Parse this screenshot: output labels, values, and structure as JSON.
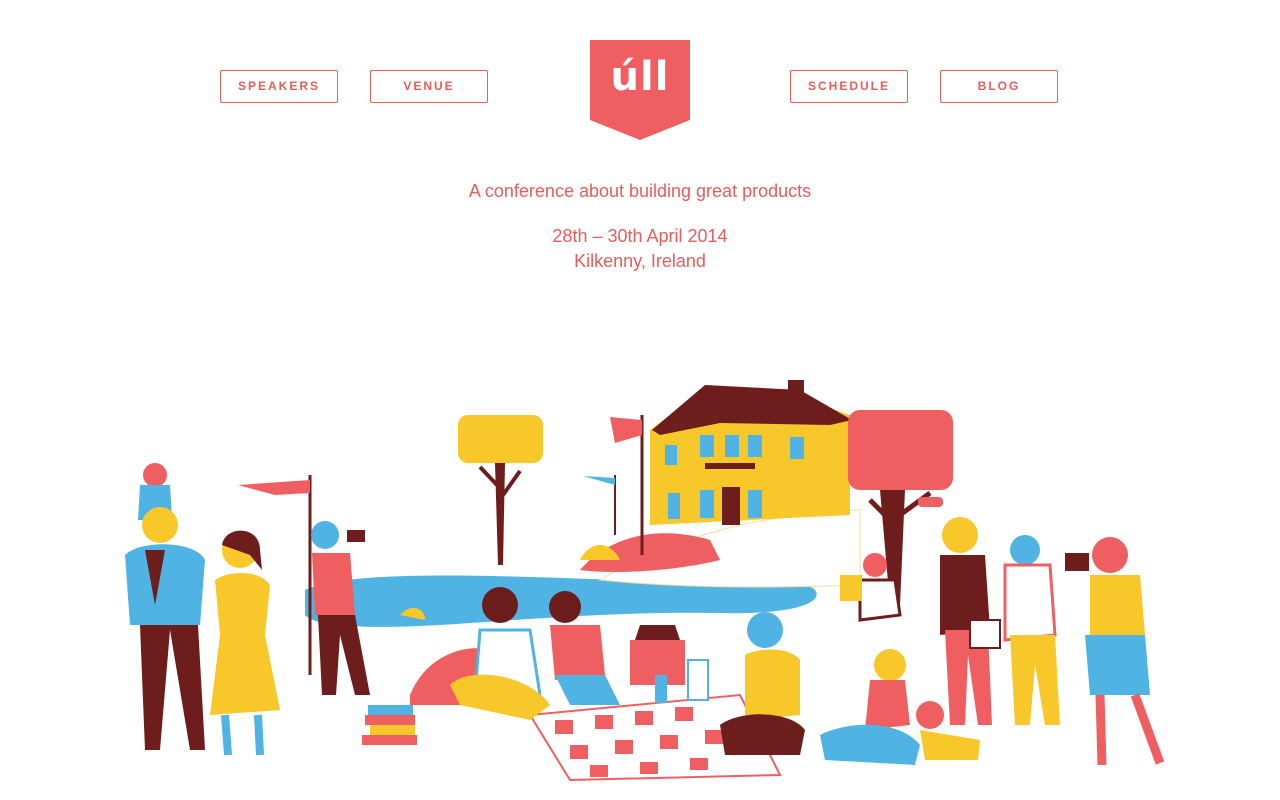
{
  "nav": {
    "speakers": "SPEAKERS",
    "venue": "VENUE",
    "schedule": "SCHEDULE",
    "blog": "BLOG"
  },
  "logo": {
    "text": "úll"
  },
  "hero": {
    "tagline": "A conference about building great products",
    "dates": "28th – 30th April 2014",
    "location": "Kilkenny, Ireland"
  },
  "colors": {
    "accent": "#e85c5a",
    "yellow": "#f8c82a",
    "blue": "#4fb3e4",
    "maroon": "#6e1d1d",
    "background": "#ffffff"
  },
  "illustration": {
    "icon": "picnic-illustration"
  }
}
